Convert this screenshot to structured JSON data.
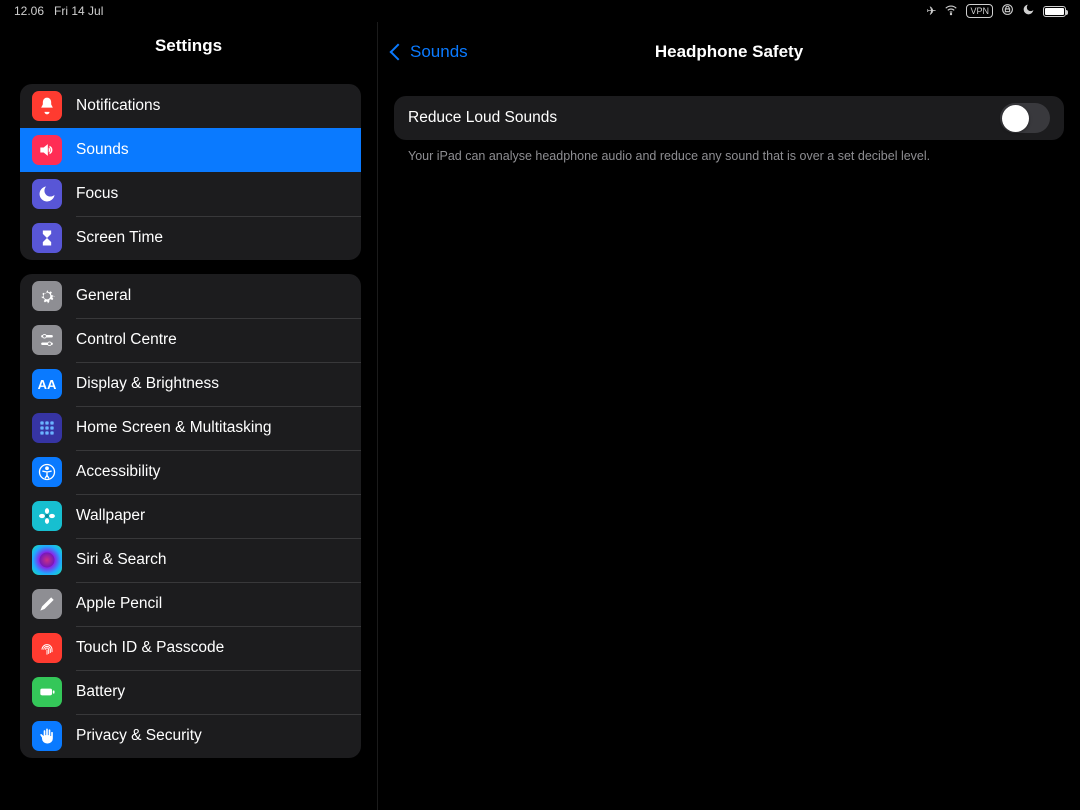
{
  "status": {
    "time": "12.06",
    "date": "Fri 14 Jul",
    "vpn_label": "VPN"
  },
  "sidebar": {
    "title": "Settings",
    "groups": [
      {
        "items": [
          {
            "id": "notifications",
            "label": "Notifications",
            "icon": "bell",
            "color": "#ff3b30"
          },
          {
            "id": "sounds",
            "label": "Sounds",
            "icon": "speaker",
            "color": "#ff2d55",
            "selected": true
          },
          {
            "id": "focus",
            "label": "Focus",
            "icon": "moon",
            "color": "#5856d6"
          },
          {
            "id": "screen-time",
            "label": "Screen Time",
            "icon": "hourglass",
            "color": "#5856d6"
          }
        ]
      },
      {
        "items": [
          {
            "id": "general",
            "label": "General",
            "icon": "gear",
            "color": "#8e8e93"
          },
          {
            "id": "control-centre",
            "label": "Control Centre",
            "icon": "sliders",
            "color": "#8e8e93"
          },
          {
            "id": "display-brightness",
            "label": "Display & Brightness",
            "icon": "aa",
            "color": "#0a7aff"
          },
          {
            "id": "home-screen",
            "label": "Home Screen & Multitasking",
            "icon": "grid",
            "color": "#3634a3"
          },
          {
            "id": "accessibility",
            "label": "Accessibility",
            "icon": "person",
            "color": "#0a7aff"
          },
          {
            "id": "wallpaper",
            "label": "Wallpaper",
            "icon": "flower",
            "color": "#17bfd0"
          },
          {
            "id": "siri-search",
            "label": "Siri & Search",
            "icon": "siri",
            "color": "#1c1c1e"
          },
          {
            "id": "apple-pencil",
            "label": "Apple Pencil",
            "icon": "pencil",
            "color": "#8e8e93"
          },
          {
            "id": "touch-id",
            "label": "Touch ID & Passcode",
            "icon": "fingerprint",
            "color": "#ff3b30"
          },
          {
            "id": "battery",
            "label": "Battery",
            "icon": "battery",
            "color": "#34c759"
          },
          {
            "id": "privacy-security",
            "label": "Privacy & Security",
            "icon": "hand",
            "color": "#0a7aff"
          }
        ]
      }
    ]
  },
  "detail": {
    "back_label": "Sounds",
    "title": "Headphone Safety",
    "rows": [
      {
        "id": "reduce-loud-sounds",
        "label": "Reduce Loud Sounds",
        "toggle": false
      }
    ],
    "footer": "Your iPad can analyse headphone audio and reduce any sound that is over a set decibel level."
  },
  "colors": {
    "accent": "#0a7aff",
    "annotation_arrow": "#ff2a12"
  }
}
